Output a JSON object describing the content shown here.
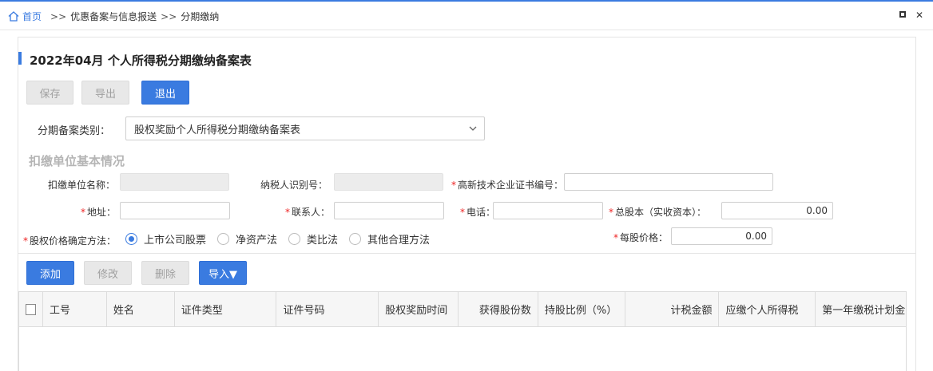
{
  "breadcrumb": {
    "home": "首页",
    "sep1": ">>",
    "level2": "优惠备案与信息报送",
    "sep2": ">>",
    "level3": "分期缴纳"
  },
  "window": {
    "restore_icon": "restore-icon",
    "close_icon": "close-icon"
  },
  "page": {
    "title": "2022年04月  个人所得税分期缴纳备案表",
    "accent_color": "#3a7be0"
  },
  "toolbar": {
    "save": "保存",
    "export": "导出",
    "exit": "退出"
  },
  "category": {
    "label": "分期备案类别：",
    "value": "股权奖励个人所得税分期缴纳备案表"
  },
  "section_title": "扣缴单位基本情况",
  "fields": {
    "withholder_name": {
      "label": "扣缴单位名称：",
      "value": ""
    },
    "taxpayer_id": {
      "label": "纳税人识别号：",
      "value": ""
    },
    "hitech_cert": {
      "label": "高新技术企业证书编号：",
      "value": ""
    },
    "address": {
      "label": "地址：",
      "value": ""
    },
    "contact": {
      "label": "联系人：",
      "value": ""
    },
    "phone": {
      "label": "电话：",
      "value": ""
    },
    "total_capital": {
      "label": "总股本（实收资本）：",
      "value": "0.00"
    },
    "price_method": {
      "label": "股权价格确定方法："
    },
    "price_per_share": {
      "label": "每股价格：",
      "value": "0.00"
    },
    "required_mark": "*"
  },
  "price_methods": [
    {
      "label": "上市公司股票",
      "selected": true
    },
    {
      "label": "净资产法",
      "selected": false
    },
    {
      "label": "类比法",
      "selected": false
    },
    {
      "label": "其他合理方法",
      "selected": false
    }
  ],
  "table_toolbar": {
    "add": "添加",
    "edit": "修改",
    "delete": "删除",
    "import": "导入▼"
  },
  "table": {
    "columns": [
      "工号",
      "姓名",
      "证件类型",
      "证件号码",
      "股权奖励时间",
      "获得股份数",
      "持股比例（%）",
      "计税金额",
      "应缴个人所得税",
      "第一年缴税计划金"
    ],
    "rows": []
  }
}
